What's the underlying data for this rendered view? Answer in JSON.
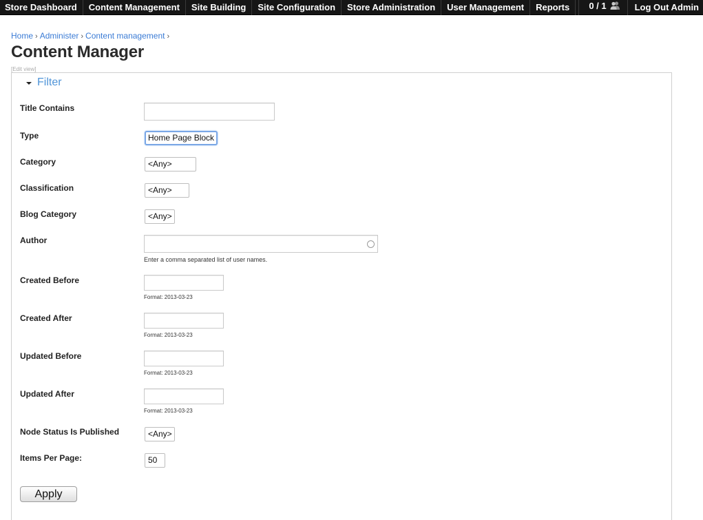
{
  "topnav": {
    "items": [
      "Store Dashboard",
      "Content Management",
      "Site Building",
      "Site Configuration",
      "Store Administration",
      "User Management",
      "Reports"
    ],
    "online_count": "0 / 1",
    "logout_label": "Log Out Admin"
  },
  "breadcrumb": {
    "items": [
      "Home",
      "Administer",
      "Content management"
    ],
    "separator": "›"
  },
  "page": {
    "title": "Content Manager",
    "edit_view": "[Edit view]"
  },
  "filter": {
    "legend": "Filter",
    "title_contains": {
      "label": "Title Contains",
      "value": ""
    },
    "type": {
      "label": "Type",
      "value": "Home Page Block"
    },
    "category": {
      "label": "Category",
      "value": "<Any>"
    },
    "classification": {
      "label": "Classification",
      "value": "<Any>"
    },
    "blog_category": {
      "label": "Blog Category",
      "value": "<Any>"
    },
    "author": {
      "label": "Author",
      "value": "",
      "description": "Enter a comma separated list of user names."
    },
    "created_before": {
      "label": "Created Before",
      "value": "",
      "description": "Format: 2013-03-23"
    },
    "created_after": {
      "label": "Created After",
      "value": "",
      "description": "Format: 2013-03-23"
    },
    "updated_before": {
      "label": "Updated Before",
      "value": "",
      "description": "Format: 2013-03-23"
    },
    "updated_after": {
      "label": "Updated After",
      "value": "",
      "description": "Format: 2013-03-23"
    },
    "node_status": {
      "label": "Node Status Is Published",
      "value": "<Any>"
    },
    "items_per_page": {
      "label": "Items Per Page:",
      "value": "50"
    },
    "apply_label": "Apply"
  },
  "icons": {
    "users": "users-icon",
    "collapse": "triangle-down-icon",
    "autocomplete": "autocomplete-throbber-icon"
  },
  "colors": {
    "topbar_bg": "#161616",
    "link": "#3a7bd5",
    "legend": "#4f94d8"
  }
}
